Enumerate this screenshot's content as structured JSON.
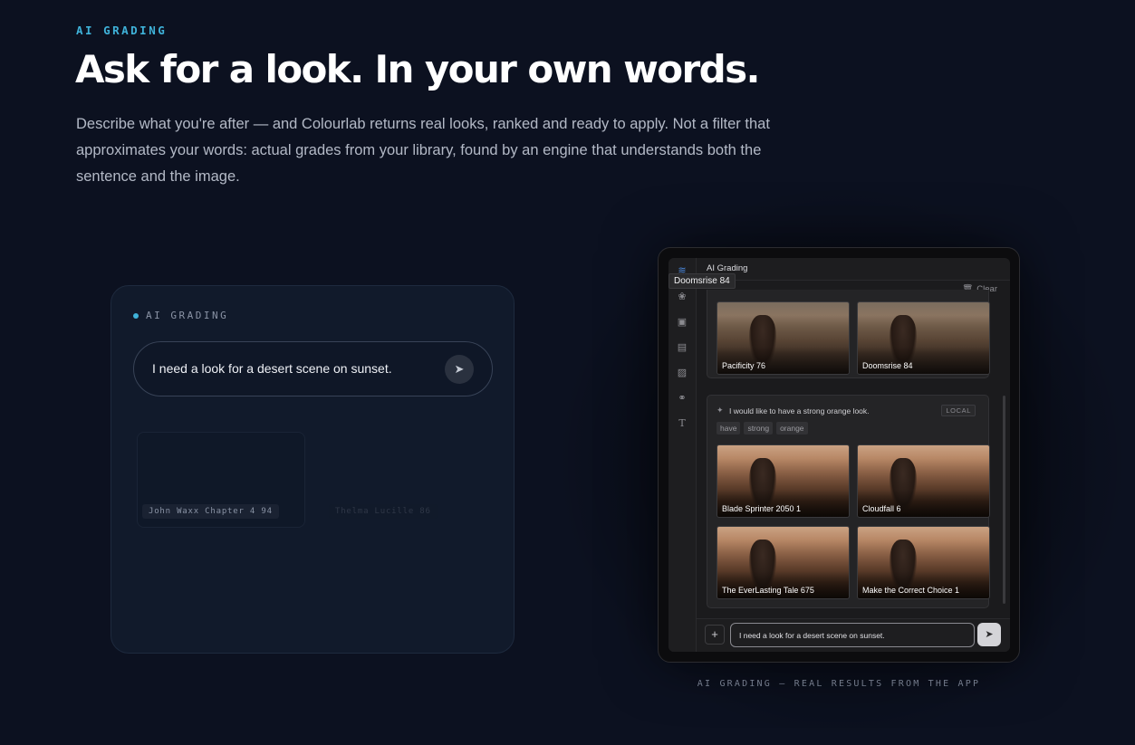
{
  "hero": {
    "eyebrow": "AI GRADING",
    "title": "Ask for a look. In your own words.",
    "description": "Describe what you're after — and Colourlab returns real looks, ranked and ready to apply. Not a filter that approximates your words: actual grades from your library, found by an engine that understands both the sentence and the image."
  },
  "demo": {
    "label": "AI GRADING",
    "input_text": "I need a look for a desert scene on sunset.",
    "send_icon": "send-arrow-icon",
    "ghost_results": [
      "John Waxx Chapter 4 94",
      "Thelma Lucille 86"
    ]
  },
  "app": {
    "header_title": "AI Grading",
    "tooltip": "Doomsrise 84",
    "clear_label": "Clear",
    "rail_icons": [
      "ai-grading-icon",
      "color-wheel-icon",
      "image-icon",
      "film-icon",
      "clapperboard-icon",
      "headphones-icon",
      "text-icon"
    ],
    "first_results": [
      {
        "name": "Pacificity 76"
      },
      {
        "name": "Doomsrise 84"
      }
    ],
    "query": {
      "text": "I would like to have a strong orange look.",
      "badge": "LOCAL",
      "chips": [
        "have",
        "strong",
        "orange"
      ],
      "results": [
        {
          "name": "Blade Sprinter 2050 1"
        },
        {
          "name": "Cloudfall 6"
        },
        {
          "name": "The EverLasting Tale 675"
        },
        {
          "name": "Make the Correct Choice 1"
        }
      ]
    },
    "chat_input": "I need a look for a desert scene on sunset.",
    "caption": "AI GRADING — REAL RESULTS FROM THE APP"
  }
}
